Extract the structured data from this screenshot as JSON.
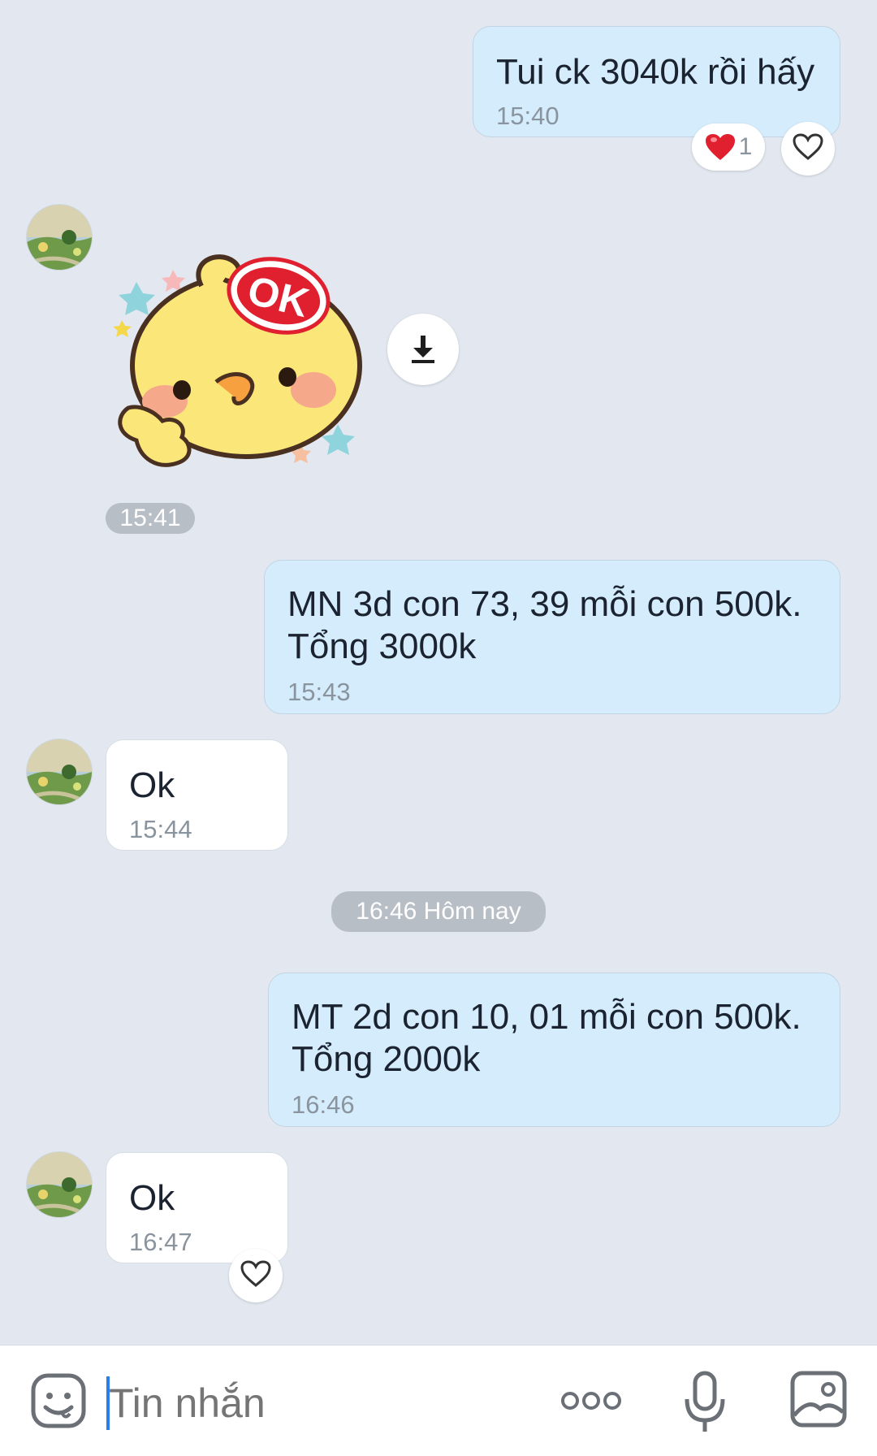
{
  "messages": [
    {
      "text": "Tui ck 3040k rồi hấy",
      "time": "15:40",
      "reaction_count": "1"
    },
    {
      "sticker_time": "15:41",
      "sticker_text": "OK"
    },
    {
      "text": "MN 3d con 73, 39 mỗi con 500k.\nTổng 3000k",
      "time": "15:43"
    },
    {
      "text": "Ok",
      "time": "15:44"
    },
    {
      "divider": "16:46 Hôm nay"
    },
    {
      "text": "MT 2d con 10, 01 mỗi con 500k.\nTổng 2000k",
      "time": "16:46"
    },
    {
      "text": "Ok",
      "time": "16:47"
    }
  ],
  "input": {
    "placeholder": "Tin nhắn"
  },
  "icons": {
    "heart_filled": "heart-filled-icon",
    "heart_outline": "heart-outline-icon",
    "download": "download-icon",
    "emoji": "emoji-icon",
    "more": "more-icon",
    "mic": "microphone-icon",
    "image": "image-icon"
  },
  "colors": {
    "my_bubble": "#d5ecfc",
    "their_bubble": "#ffffff",
    "background": "#e3e8f0",
    "reaction_heart": "#e0202f",
    "cursor": "#2b7de9"
  }
}
